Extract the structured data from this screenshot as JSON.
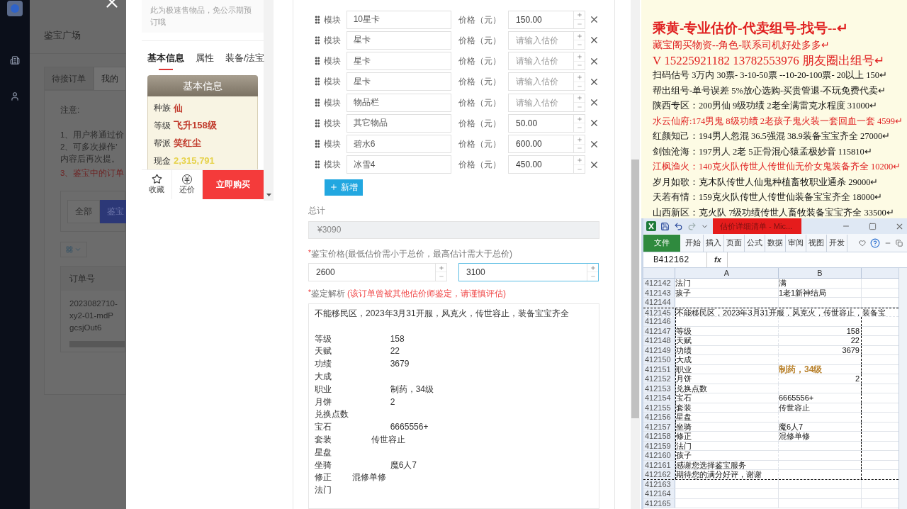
{
  "background_page": {
    "title": "鉴宝广场",
    "tabs": [
      {
        "label": "待接订单",
        "selected": false
      },
      {
        "label": "我的",
        "selected": true
      }
    ],
    "notice_title": "注意:",
    "notice_lines": [
      {
        "text": "1、用户将通过价",
        "kind": "normal"
      },
      {
        "text": "2、可多次操作'",
        "kind": "normal"
      },
      {
        "text": "内容后再次提。",
        "kind": "normal"
      },
      {
        "text": "3、鉴宝中的订单",
        "kind": "warning"
      }
    ],
    "filters": [
      {
        "label": "全部",
        "selected": false
      },
      {
        "label": "鉴宝",
        "selected": true
      }
    ],
    "table": {
      "columns": [
        "订单号"
      ],
      "rows": [
        [
          "2023082710-xy2-01-mdPgcsjOut6"
        ]
      ]
    }
  },
  "preview": {
    "notice": "此为极速售物品，免公示期预订哦",
    "tabs": [
      {
        "label": "基本信息",
        "selected": true
      },
      {
        "label": "属性",
        "selected": false
      },
      {
        "label": "装备/法宝",
        "selected": false
      }
    ],
    "card": {
      "title": "基本信息",
      "rows": [
        {
          "label": "种族",
          "value": "仙",
          "color": "#c0392b"
        },
        {
          "label": "等级",
          "value": "飞升158级",
          "color": "#c0392b"
        },
        {
          "label": "帮派",
          "value": "笑红尘",
          "color": "#c0392b"
        },
        {
          "label": "现金",
          "value": "2,315,791",
          "color": "#e6d24a"
        }
      ]
    },
    "actions": [
      "收藏",
      "还价"
    ],
    "buy_button": "立即购买"
  },
  "form": {
    "items": [
      {
        "label": "模块",
        "name": "10星卡",
        "price_label": "价格（元）",
        "price": "150.00"
      },
      {
        "label": "模块",
        "name": "星卡",
        "price_label": "价格（元）",
        "placeholder": "请输入估价"
      },
      {
        "label": "模块",
        "name": "星卡",
        "price_label": "价格（元）",
        "placeholder": "请输入估价"
      },
      {
        "label": "模块",
        "name": "星卡",
        "price_label": "价格（元）",
        "placeholder": "请输入估价"
      },
      {
        "label": "模块",
        "name": "物品栏",
        "price_label": "价格（元）",
        "placeholder": "请输入估价"
      },
      {
        "label": "模块",
        "name": "其它物品",
        "price_label": "价格（元）",
        "price": "50.00"
      },
      {
        "label": "模块",
        "name": "碧水6",
        "price_label": "价格（元）",
        "price": "600.00"
      },
      {
        "label": "模块",
        "name": "冰雪4",
        "price_label": "价格（元）",
        "price": "450.00"
      }
    ],
    "add_button": "新增",
    "total_label": "总计",
    "total": "¥3090",
    "price_range_label": {
      "required_mark": "*",
      "text": "鉴宝价格(最低估价需小于总价，最高估计需大于总价)"
    },
    "price_min": "2600",
    "price_max": "3100",
    "analysis_label": {
      "required_mark": "*",
      "text": "鉴定解析"
    },
    "analysis_warning": "(该订单曾被其他估价师鉴定，请谨慎评估)",
    "analysis": [
      {
        "text": "不能移民区，2023年3月31开服，风克火，传世容止，装备宝宝齐全",
        "kind": "paragraph"
      },
      {
        "text": "等级\t\t\t\t158",
        "kind": "row"
      },
      {
        "text": "天赋\t\t\t\t22",
        "kind": "row"
      },
      {
        "text": "功绩\t\t\t\t3679",
        "kind": "row"
      },
      {
        "text": "大成",
        "kind": "row"
      },
      {
        "text": "职业\t\t\t\t制药，34级",
        "kind": "row"
      },
      {
        "text": "月饼\t\t\t\t2",
        "kind": "row"
      },
      {
        "text": "兑换点数",
        "kind": "row"
      },
      {
        "text": "宝石\t\t\t\t6665556+",
        "kind": "row"
      },
      {
        "text": "套装\t\t\t传世容止",
        "kind": "row"
      },
      {
        "text": "星盘",
        "kind": "row"
      },
      {
        "text": "坐骑\t\t\t\t魔6人7",
        "kind": "row"
      },
      {
        "text": "修正\t\t混修单修",
        "kind": "row"
      },
      {
        "text": "法门",
        "kind": "row"
      }
    ]
  },
  "document": {
    "lines": [
      {
        "text": "乘黄-专业估价-代卖组号-找号--↵",
        "kind": "title",
        "color": "#e02020"
      },
      {
        "text": "藏宝阁买物资--角色-联系司机好处多多↵",
        "kind": "medium",
        "color": "#e02020"
      },
      {
        "text": "V 15225921182   13782553976 朋友圈出组号↵",
        "kind": "big",
        "color": "#e02020"
      },
      {
        "text": "扫码估号 3万内 30票- 3-10-50票  --10-20-100票- 20以上 150↵",
        "kind": "normal",
        "color": "#111111"
      },
      {
        "text": "帮出组号-单号误差 5%放心选购-买贵管退-不玩免费代卖↵",
        "kind": "normal",
        "color": "#111111"
      },
      {
        "text": "陕西专区：200男仙 9级功绩 2老全满雷克水程度 31000↵",
        "kind": "normal",
        "color": "#111111"
      },
      {
        "text": "水云仙府:174男鬼 8级功绩 2老孩子鬼火装一套回血一套 4599↵",
        "kind": "normal",
        "color": "#e02020"
      },
      {
        "text": "红颜知己：194男人忽混 36.5强混 38.9装备宝宝齐全 27000↵",
        "kind": "normal",
        "color": "#111111"
      },
      {
        "text": "剑蚀沧海：197男人 2老 5正骨混心猿孟极妙音 115810↵",
        "kind": "normal",
        "color": "#111111"
      },
      {
        "text": "江枫渔火：140克火队传世人传世仙无价女鬼装备齐全 10200↵",
        "kind": "normal",
        "color": "#e02020"
      },
      {
        "text": "岁月如歌：克木队传世人仙鬼种植畜牧职业通杀 29000↵",
        "kind": "normal",
        "color": "#111111"
      },
      {
        "text": "天若有情：159克火队传世人传世仙装备宝宝齐全 18000↵",
        "kind": "normal",
        "color": "#111111"
      },
      {
        "text": "山西新区：克火队 7级功绩传世人畜牧装备宝宝齐全 33500↵",
        "kind": "normal",
        "color": "#111111"
      }
    ]
  },
  "spreadsheet": {
    "title": "估价详细清单 - Mic...",
    "ribbon_tabs": [
      {
        "label": "文件",
        "selected": true
      },
      {
        "label": "开始",
        "selected": false
      },
      {
        "label": "插入",
        "selected": false
      },
      {
        "label": "页面",
        "selected": false
      },
      {
        "label": "公式",
        "selected": false
      },
      {
        "label": "数据",
        "selected": false
      },
      {
        "label": "审阅",
        "selected": false
      },
      {
        "label": "视图",
        "selected": false
      },
      {
        "label": "开发",
        "selected": false
      }
    ],
    "name_box": "B412162",
    "fx_label": "fx",
    "columns": [
      "A",
      "B"
    ],
    "rows": [
      {
        "number": "412142",
        "a": "法门",
        "b": "满",
        "kind": "normal",
        "copied": false
      },
      {
        "number": "412143",
        "a": "孩子",
        "b": "1老1新神结局",
        "kind": "normal",
        "copied": false
      },
      {
        "number": "412144",
        "kind": "normal",
        "copied": false
      },
      {
        "number": "412145",
        "a": "不能移民区，2023年3月31开服，风克火，传世容止，装备宝",
        "kind": "spill",
        "copied": true
      },
      {
        "number": "412146",
        "kind": "normal",
        "copied": true
      },
      {
        "number": "412147",
        "a": "等级",
        "b": {
          "text": "158",
          "kind": "number"
        },
        "kind": "normal",
        "copied": true
      },
      {
        "number": "412148",
        "a": "天赋",
        "b": {
          "text": "22",
          "kind": "number"
        },
        "kind": "normal",
        "copied": true
      },
      {
        "number": "412149",
        "a": "功绩",
        "b": {
          "text": "3679",
          "kind": "number"
        },
        "kind": "normal",
        "copied": true
      },
      {
        "number": "412150",
        "a": "大成",
        "kind": "normal",
        "copied": true
      },
      {
        "number": "412151",
        "a": "职业",
        "b": {
          "text": "制药，34级",
          "kind": "highlight"
        },
        "kind": "normal",
        "copied": true
      },
      {
        "number": "412152",
        "a": "月饼",
        "b": {
          "text": "2",
          "kind": "number"
        },
        "kind": "normal",
        "copied": true
      },
      {
        "number": "412153",
        "a": "兑换点数",
        "kind": "normal",
        "copied": true
      },
      {
        "number": "412154",
        "a": "宝石",
        "b": "6665556+",
        "kind": "normal",
        "copied": true
      },
      {
        "number": "412155",
        "a": "套装",
        "b": "传世容止",
        "kind": "normal",
        "copied": true
      },
      {
        "number": "412156",
        "a": "星盘",
        "kind": "normal",
        "copied": true
      },
      {
        "number": "412157",
        "a": "坐骑",
        "b": "魔6人7",
        "kind": "normal",
        "copied": true
      },
      {
        "number": "412158",
        "a": "修正",
        "b": "混修单修",
        "kind": "normal",
        "copied": true
      },
      {
        "number": "412159",
        "a": "法门",
        "kind": "normal",
        "copied": true
      },
      {
        "number": "412160",
        "a": "孩子",
        "kind": "normal",
        "copied": true
      },
      {
        "number": "412161",
        "a": "感谢您选择鉴宝服务",
        "kind": "normal",
        "copied": true
      },
      {
        "number": "412162",
        "a": "期待您的满分好评，谢谢",
        "kind": "normal",
        "copied": true
      },
      {
        "number": "412163",
        "kind": "normal",
        "copied": false
      },
      {
        "number": "412164",
        "kind": "normal",
        "copied": false
      },
      {
        "number": "412165",
        "kind": "normal",
        "copied": false
      }
    ]
  }
}
